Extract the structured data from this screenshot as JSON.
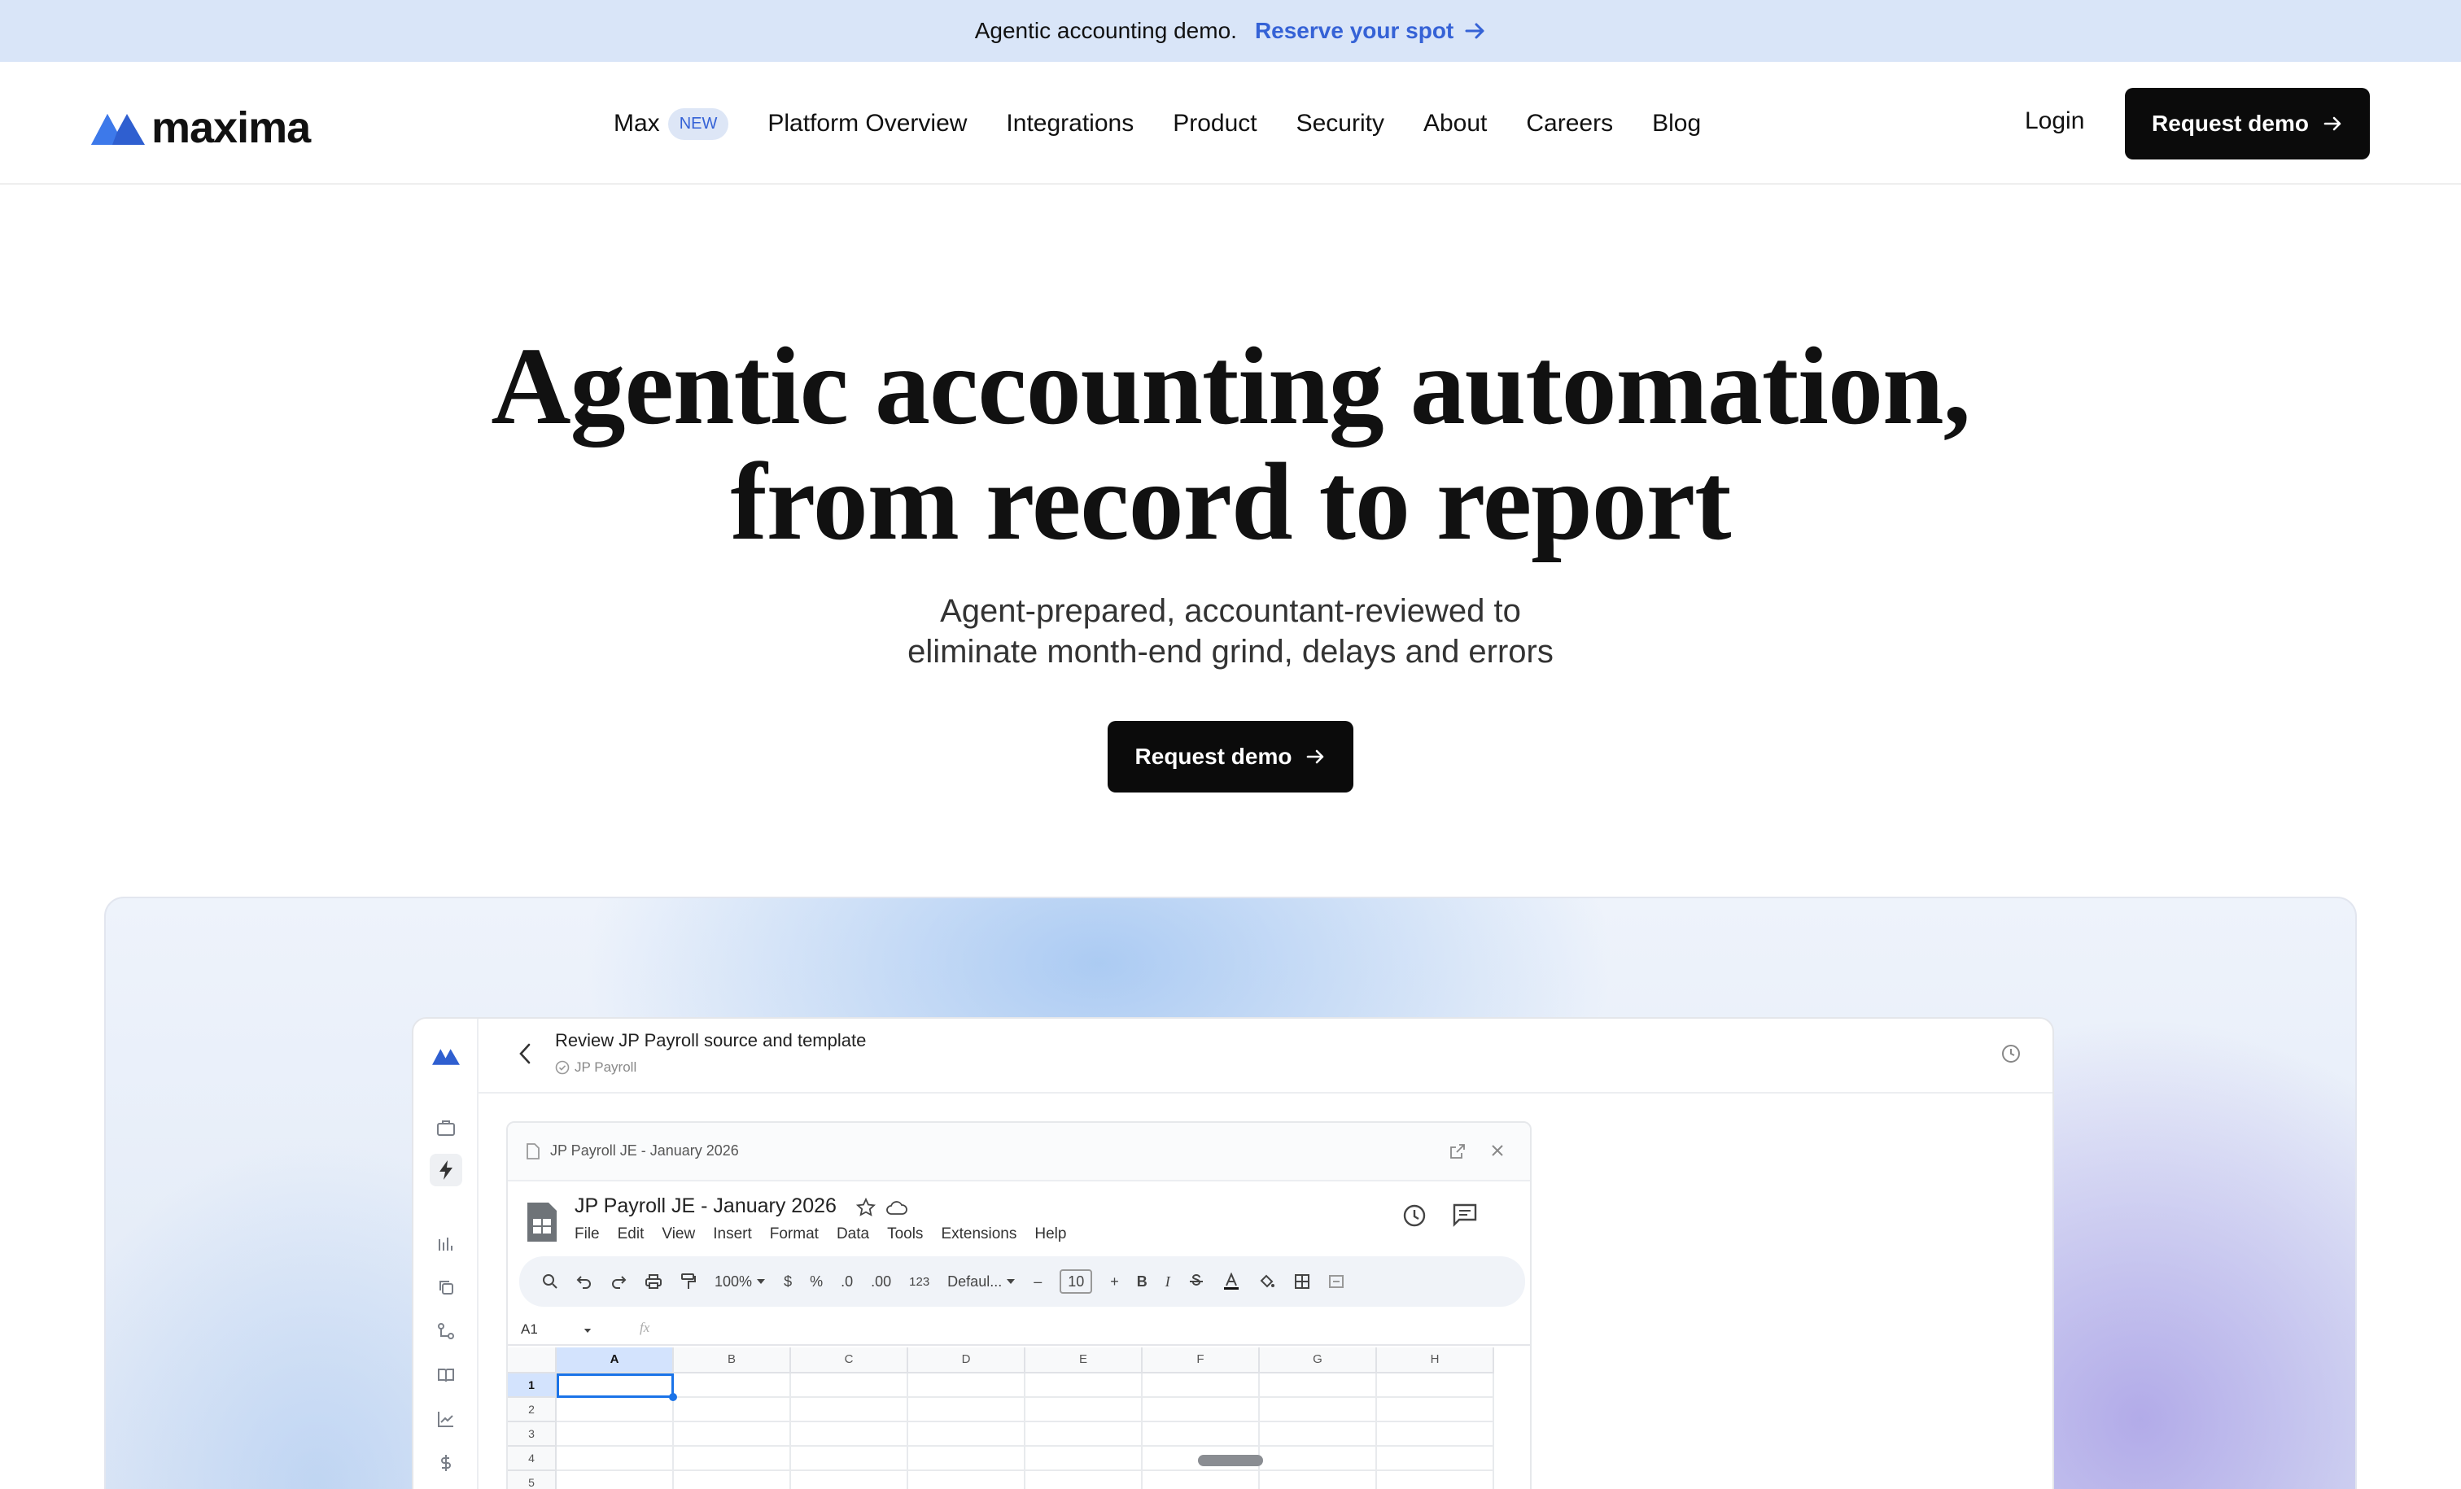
{
  "announcement": {
    "text": "Agentic accounting demo.",
    "link_label": "Reserve your spot"
  },
  "nav": {
    "logo_text": "maxima",
    "items": [
      {
        "label": "Max",
        "badge": "NEW"
      },
      {
        "label": "Platform Overview"
      },
      {
        "label": "Integrations"
      },
      {
        "label": "Product"
      },
      {
        "label": "Security"
      },
      {
        "label": "About"
      },
      {
        "label": "Careers"
      },
      {
        "label": "Blog"
      }
    ],
    "login_label": "Login",
    "cta_label": "Request demo"
  },
  "hero": {
    "title_line1": "Agentic accounting automation,",
    "title_line2": "from record to report",
    "subtitle_line1": "Agent-prepared, accountant-reviewed to",
    "subtitle_line2": "eliminate month-end grind, delays and errors",
    "cta_label": "Request demo"
  },
  "app_preview": {
    "title": "Review JP Payroll source and template",
    "crumb": "JP Payroll",
    "sheet_tab_name": "JP Payroll JE - January 2026",
    "sheet_title": "JP Payroll JE - January 2026",
    "menu": [
      "File",
      "Edit",
      "View",
      "Insert",
      "Format",
      "Data",
      "Tools",
      "Extensions",
      "Help"
    ],
    "toolbar": {
      "zoom": "100%",
      "currency": "$",
      "percent": "%",
      "dec_minus": ".0",
      "dec_plus": ".00",
      "number_format": "123",
      "font": "Defaul...",
      "font_size": "10",
      "bold": "B",
      "italic": "I"
    },
    "cell_ref": "A1",
    "fx_label": "fx",
    "columns": [
      "A",
      "B",
      "C",
      "D",
      "E",
      "F",
      "G",
      "H"
    ],
    "rows": [
      "1",
      "2",
      "3",
      "4",
      "5"
    ]
  },
  "colors": {
    "announce_bg": "#d9e5f8",
    "brand_blue": "#3562d6",
    "cta_bg": "#0b0b0b"
  }
}
